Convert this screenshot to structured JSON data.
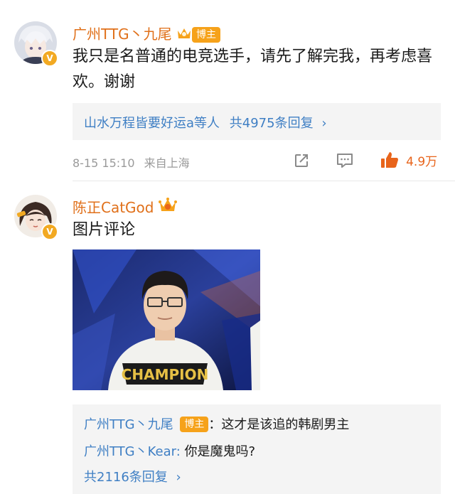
{
  "comment1": {
    "username": "广州TTG丶九尾",
    "badge": "博主",
    "text": "我只是名普通的电竞选手，请先了解完我，再考虑喜欢。谢谢",
    "reply_summary_names": "山水万程皆要好运a等人",
    "reply_summary_count": "共4975条回复",
    "reply_chevron": "›",
    "time": "8-15 15:10",
    "location": "来自上海",
    "like_count": "4.9万"
  },
  "comment2": {
    "username": "陈正CatGod",
    "text": "图片评论",
    "image_caption": "CHAMPION",
    "replies": [
      {
        "user": "广州TTG丶九尾",
        "badge": "博主",
        "sep": "：",
        "text": "这才是该追的韩剧男主"
      },
      {
        "user": "广州TTG丶Kear",
        "sep": ":",
        "text": " 你是魔鬼吗?"
      }
    ],
    "more_replies": "共2116条回复",
    "more_chevron": "›"
  },
  "colors": {
    "username": "#e0701a",
    "link_blue": "#3f7fc4",
    "like_orange": "#e8641b",
    "badge_orange": "#f6a21a",
    "meta_gray": "#9a9a9a"
  },
  "icons": [
    "verified-badge-icon",
    "crown-icon",
    "share-icon",
    "comment-icon",
    "like-icon"
  ]
}
